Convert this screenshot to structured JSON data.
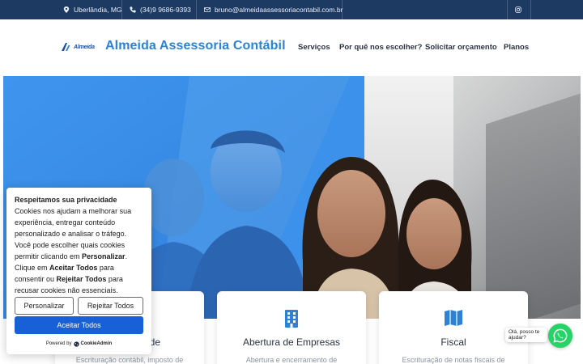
{
  "topbar": {
    "location": "Uberlândia, MG",
    "phone": "(34)9 9686-9393",
    "email": "bruno@almeidaassessoriacontabil.com.br",
    "social_icon": "instagram-icon"
  },
  "header": {
    "logo_word": "Almeida",
    "brand": "Almeida Assessoria Contábil",
    "nav": [
      "Serviços",
      "Por quê nos escolher?",
      "Solicitar orçamento",
      "Planos"
    ]
  },
  "cards": [
    {
      "title": "de",
      "desc": "Escrituração contábil, imposto de",
      "icon": "calculator-icon"
    },
    {
      "title": "Abertura de Empresas",
      "desc": "Abertura e encerramento de",
      "icon": "building-icon"
    },
    {
      "title": "Fiscal",
      "desc": "Escrituração de notas fiscais de",
      "icon": "map-icon"
    }
  ],
  "cookie": {
    "title": "Respeitamos sua privacidade",
    "text_1": "Cookies nos ajudam a melhorar sua experiência, entregar conteúdo personalizado e analisar o tráfego. Você pode escolher quais cookies permitir clicando em ",
    "text_bold_1": "Personalizar",
    "text_2": ". Clique em ",
    "text_bold_2": "Aceitar Todos",
    "text_3": " para consentir ou ",
    "text_bold_3": "Rejeitar Todos",
    "text_4": " para recusar cookies não essenciais.",
    "customize": "Personalizar",
    "reject": "Rejeitar Todos",
    "accept": "Aceitar Todos",
    "powered_by": "Powered by",
    "powered_brand": "CookieAdmin"
  },
  "whatsapp": {
    "bubble": "Olá, posso te ajudar?",
    "icon": "whatsapp-icon"
  },
  "colors": {
    "topbar": "#1d3a63",
    "brand": "#2b82d6",
    "hero_blue": "#3c92ea",
    "accept_button": "#1760d8",
    "whatsapp": "#25d366"
  }
}
